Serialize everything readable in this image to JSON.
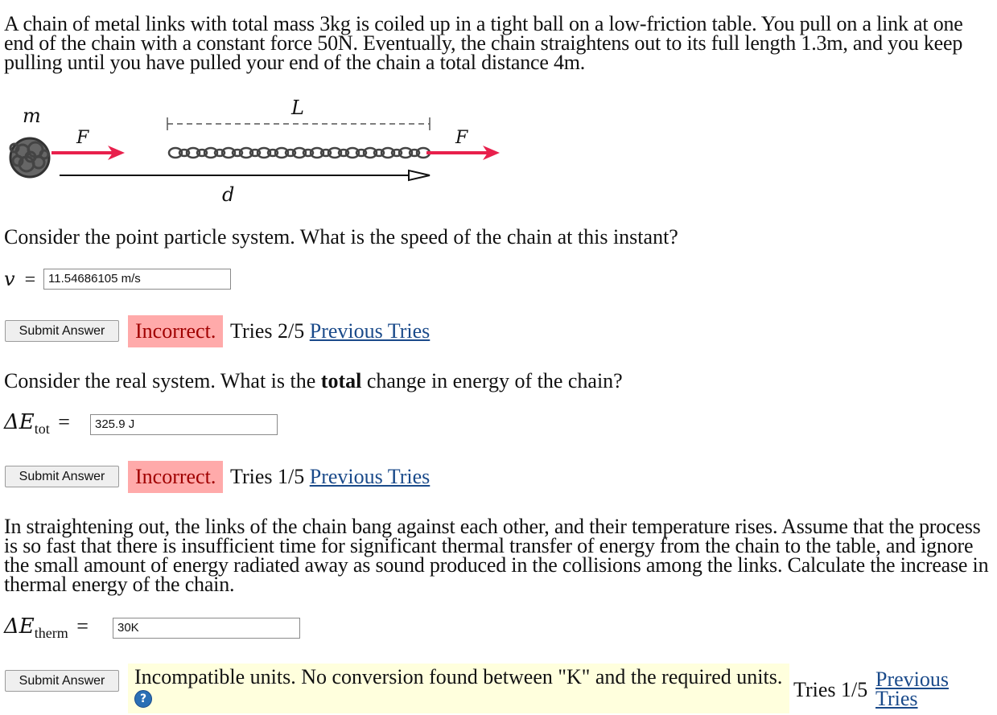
{
  "intro": "A chain of metal links with total mass 3kg is coiled up in a tight ball on a low-friction table. You pull on a link at one end of the chain with a constant force 50N. Eventually, the chain straightens out to its full length 1.3m, and you keep pulling until you have pulled your end of the chain a total distance 4m.",
  "diagram": {
    "mass_label": "m",
    "force_label": "F",
    "length_label": "L",
    "distance_label": "d",
    "colors": {
      "arrow": "#e8204c",
      "chain": "#444444",
      "axis": "#111111"
    }
  },
  "q1": {
    "prompt": "Consider the point particle system. What is the speed of the chain at this instant?",
    "var": "v",
    "eq": "=",
    "value": "11.54686105 m/s",
    "submit": "Submit Answer",
    "status": "Incorrect.",
    "tries": "Tries 2/5",
    "prev": "Previous Tries"
  },
  "q2": {
    "prompt_pre": "Consider the real system. What is the ",
    "prompt_bold": "total",
    "prompt_post": " change in energy of the chain?",
    "var": "ΔE",
    "sub": "tot",
    "eq": "=",
    "value": "325.9 J",
    "submit": "Submit Answer",
    "status": "Incorrect.",
    "tries": "Tries 1/5",
    "prev": "Previous Tries"
  },
  "q3": {
    "prompt": "In straightening out, the links of the chain bang against each other, and their temperature rises. Assume that the process is so fast that there is insufficient time for significant thermal transfer of energy from the chain to the table, and ignore the small amount of energy radiated away as sound produced in the collisions among the links. Calculate the increase in thermal energy of the chain.",
    "var": "ΔE",
    "sub": "therm",
    "eq": "=",
    "value": "30K",
    "submit": "Submit Answer",
    "status": "Incompatible units. No conversion found between \"K\" and the required units.",
    "help_icon": "?",
    "tries": "Tries 1/5",
    "prev_line1": "Previous",
    "prev_line2": "Tries"
  }
}
